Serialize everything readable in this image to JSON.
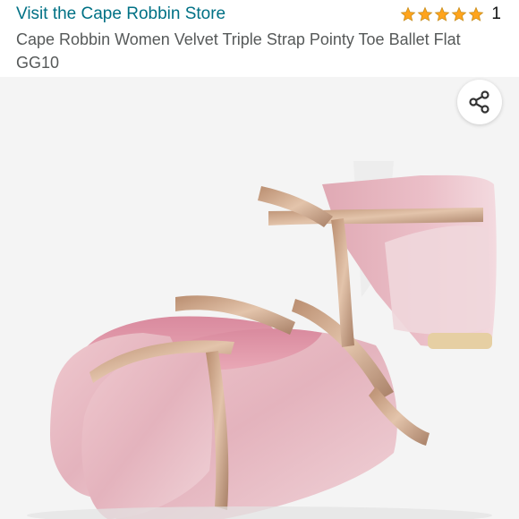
{
  "store": {
    "link_text": "Visit the Cape Robbin Store"
  },
  "rating": {
    "stars": 5,
    "max_stars": 5,
    "count": "1",
    "star_color": "#FFA41C"
  },
  "product": {
    "title": "Cape Robbin Women Velvet Triple Strap Pointy Toe Ballet Flat GG10",
    "color_velvet": "#e9c3cb",
    "color_straps": "#c9a58a"
  },
  "share": {
    "icon": "share-icon"
  },
  "colors": {
    "link": "#007185",
    "title": "#565959",
    "background": "#f4f4f4"
  }
}
